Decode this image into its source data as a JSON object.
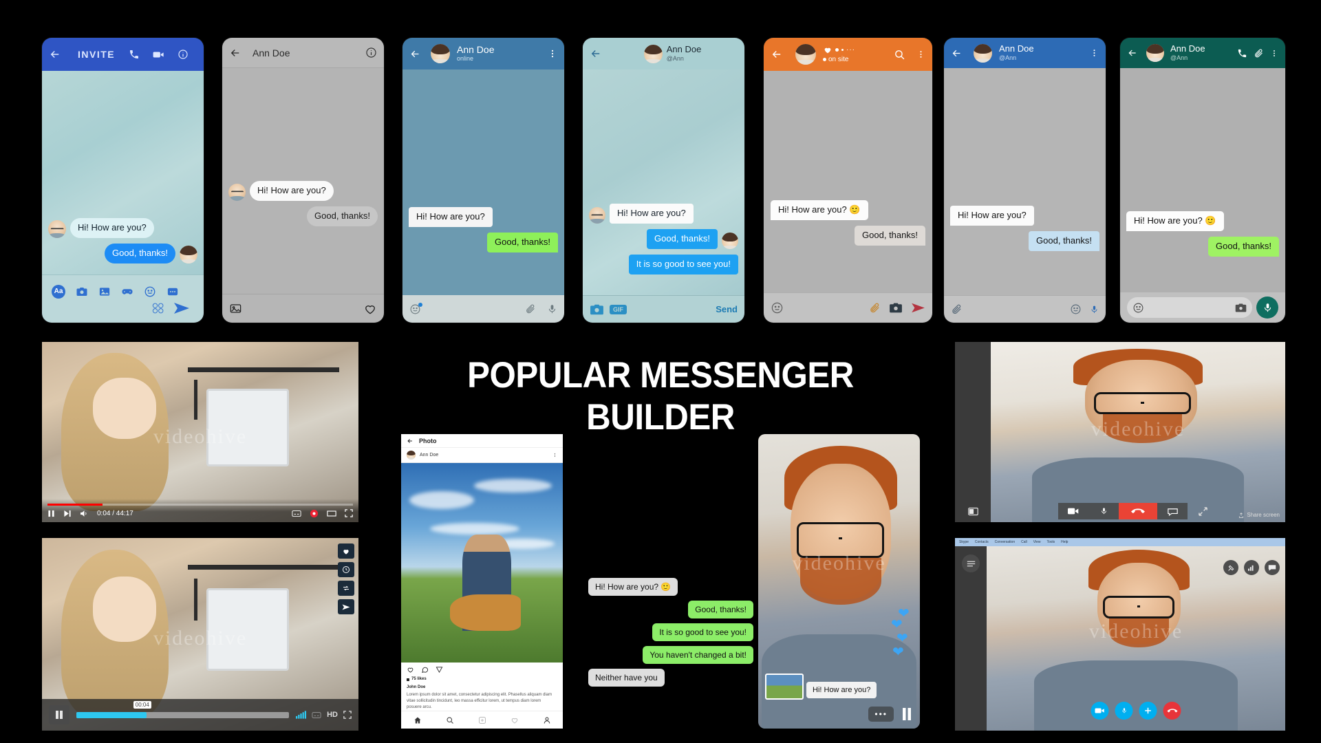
{
  "title": "POPULAR MESSENGER BUILDER",
  "contact": {
    "name": "Ann Doe",
    "handle": "@Ann",
    "status_online": "online",
    "status_onsite": "on site"
  },
  "messages": {
    "hi": "Hi! How are you?",
    "hi_emoji": "Hi! How are you? 🙂",
    "good": "Good, thanks!",
    "see": "It is so good to see you!",
    "changed": "You haven't changed a bit!",
    "neither": "Neither have you"
  },
  "phones": [
    {
      "id": "messenger",
      "app": "Facebook Messenger",
      "header": {
        "back": "back-arrow-icon",
        "invite_label": "INVITE",
        "icons": [
          "phone-icon",
          "video-camera-icon",
          "info-icon"
        ]
      },
      "accent": "#2f55c4",
      "toolbar": [
        "text-format-icon",
        "camera-icon",
        "photo-icon",
        "game-controller-icon",
        "emoji-icon",
        "more-icon"
      ],
      "quick": [
        "sticker-icon",
        "send-icon"
      ]
    },
    {
      "id": "instagram-direct",
      "app": "Instagram Direct",
      "header": {
        "back": "back-arrow-icon",
        "title": "Ann Doe",
        "icons": [
          "info-icon"
        ]
      },
      "accent": "#b9b9b9",
      "toolbar": [
        "photo-icon",
        "heart-icon"
      ]
    },
    {
      "id": "telegram",
      "app": "Telegram",
      "header": {
        "back": "back-arrow-icon",
        "title": "Ann Doe",
        "subtitle": "online",
        "icons": [
          "more-vertical-icon"
        ]
      },
      "accent": "#3f7aa8",
      "toolbar": [
        "emoji-icon",
        "paperclip-icon",
        "microphone-icon"
      ]
    },
    {
      "id": "twitter-dm",
      "app": "Twitter Direct Message",
      "header": {
        "back": "back-arrow-icon",
        "title": "Ann Doe",
        "subtitle": "@Ann"
      },
      "accent": "#1da1f2",
      "toolbar": [
        "camera-icon",
        "gif-icon"
      ],
      "send_label": "Send",
      "gif_label": "GIF"
    },
    {
      "id": "odnoklassniki",
      "app": "OK Messenger",
      "header": {
        "back": "back-arrow-icon",
        "status": "on site",
        "icons": [
          "heart-icon",
          "search-icon",
          "more-vertical-icon"
        ]
      },
      "accent": "#e8762a",
      "toolbar": [
        "emoji-icon",
        "paperclip-icon",
        "camera-icon",
        "send-icon"
      ]
    },
    {
      "id": "vk",
      "app": "VK Messages",
      "header": {
        "back": "back-arrow-icon",
        "title": "Ann Doe",
        "subtitle": "@Ann",
        "icons": [
          "more-vertical-icon"
        ]
      },
      "accent": "#2d6bb5",
      "toolbar": [
        "paperclip-icon",
        "emoji-icon",
        "microphone-icon"
      ]
    },
    {
      "id": "whatsapp",
      "app": "WhatsApp",
      "header": {
        "back": "back-arrow-icon",
        "title": "Ann Doe",
        "subtitle": "@Ann",
        "icons": [
          "phone-icon",
          "paperclip-icon",
          "more-vertical-icon"
        ]
      },
      "accent": "#0c5c52",
      "toolbar": [
        "emoji-icon",
        "camera-icon",
        "microphone-icon"
      ]
    }
  ],
  "youtube_player": {
    "time": "0:04 / 44:17",
    "controls": [
      "pause-icon",
      "next-icon",
      "volume-icon"
    ],
    "right_controls": [
      "subtitles-icon",
      "settings-icon",
      "theater-mode-icon",
      "fullscreen-icon"
    ],
    "progress_percent": 18,
    "watermark": "videohive"
  },
  "vk_player": {
    "tooltip_time": "00:04",
    "quality_label": "HD",
    "controls": [
      "pause-icon",
      "volume-bars-icon",
      "subtitles-icon",
      "fullscreen-icon"
    ],
    "side_actions": [
      "heart-icon",
      "clock-icon",
      "repost-icon",
      "send-icon"
    ],
    "progress_percent": 33,
    "watermark": "videohive"
  },
  "instagram_post": {
    "header_title": "Photo",
    "author": "Ann Doe",
    "likes": "75 likes",
    "caption_author": "John Doe",
    "caption": "Lorem ipsum dolor sit amet, consectetur adipiscing elit. Phasellus aliquam diam vitae sollicitudin tincidunt, leo massa efficitur lorem, ut tempus diam lorem posuere arcu.",
    "actions": [
      "heart-icon",
      "comment-icon",
      "share-icon"
    ],
    "nav": [
      "home-icon",
      "search-icon",
      "add-icon",
      "activity-icon",
      "profile-icon"
    ]
  },
  "mobile_video_call": {
    "bubble": "Hi! How are you?",
    "controls": [
      "more-icon",
      "pause-icon"
    ]
  },
  "hangouts_call": {
    "share_label": "Share screen",
    "controls": [
      "video-camera-icon",
      "microphone-icon",
      "hangup-icon",
      "chat-icon",
      "fullscreen-icon"
    ],
    "left_control": "presentation-icon",
    "watermark": "videohive"
  },
  "skype_call": {
    "menu": [
      "Skype",
      "Contacts",
      "Conversation",
      "Call",
      "View",
      "Tools",
      "Help"
    ],
    "tools": [
      "pin-icon",
      "signal-icon",
      "chat-icon"
    ],
    "controls": [
      "video-camera-icon",
      "microphone-icon",
      "add-person-icon",
      "hangup-icon"
    ],
    "left_control": "menu-icon",
    "watermark": "videohive"
  },
  "colors": {
    "messenger_blue": "#2f55c4",
    "telegram_blue": "#3f7aa8",
    "twitter_blue": "#1da1f2",
    "ok_orange": "#e8762a",
    "vk_blue": "#2d6bb5",
    "whatsapp_green": "#0c5c52",
    "bubble_green": "#8ced68",
    "hangup_red": "#ea4335",
    "skype_blue": "#00aff0",
    "youtube_red": "#ff0000"
  }
}
